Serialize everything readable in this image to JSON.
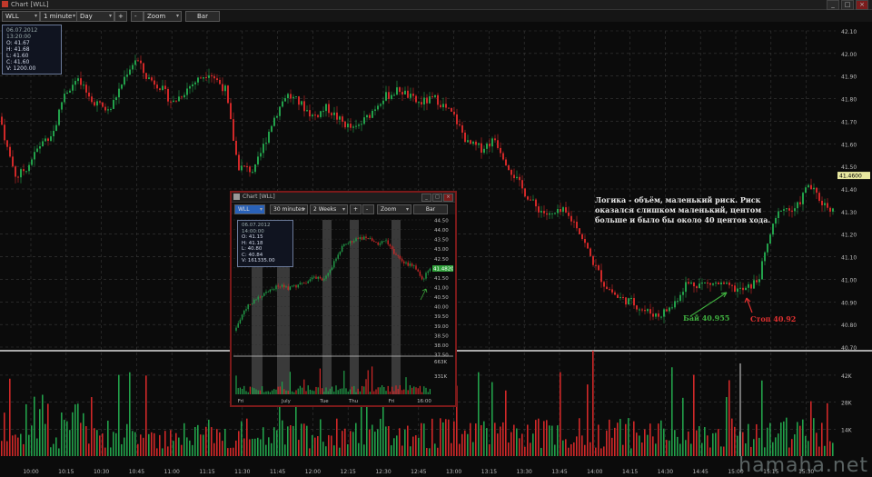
{
  "window": {
    "title": "Chart [WLL]",
    "minimize": "_",
    "maximize": "□",
    "close": "×"
  },
  "toolbar": {
    "symbol": "WLL",
    "interval": "1 minute",
    "period": "Day",
    "plus": "+",
    "minus": "-",
    "zoom": "Zoom",
    "bar": "Bar"
  },
  "infobox": {
    "date": "06.07.2012 13:20:00",
    "open": "O: 41.67",
    "high": "H: 41.68",
    "low": "L: 41.60",
    "close": "C: 41.60",
    "volume": "V: 1200.00"
  },
  "annotation": {
    "line1": "Логика - объём, маленький риск. Риск",
    "line2": "оказался слишком маленький, центом",
    "line3": "больше и было бы около 40 центов хода.",
    "buy": "Бай 40.955",
    "stop": "Стоп 40.92"
  },
  "watermark": "hamaha.net",
  "colors": {
    "up": "#22a04a",
    "down": "#d02828",
    "grid": "#3a3a3a",
    "last_price_bg": "#e8e8a0"
  },
  "chart_data": {
    "type": "candlestick",
    "price_ticks": [
      "42.10",
      "42.00",
      "41.90",
      "41.80",
      "41.70",
      "41.60",
      "41.50",
      "41.40",
      "41.30",
      "41.20",
      "41.10",
      "41.00",
      "40.90",
      "40.80",
      "40.70"
    ],
    "volume_ticks": [
      "42K",
      "28K",
      "14K"
    ],
    "time_ticks": [
      "10:00",
      "10:15",
      "10:30",
      "10:45",
      "11:00",
      "11:15",
      "11:30",
      "11:45",
      "12:00",
      "12:15",
      "12:30",
      "12:45",
      "13:00",
      "13:15",
      "13:30",
      "13:45",
      "14:00",
      "14:15",
      "14:30",
      "14:45",
      "15:00",
      "15:15",
      "15:30"
    ],
    "last_price": "41.4600",
    "ylim": [
      40.7,
      42.1
    ],
    "path": [
      [
        0,
        41.72
      ],
      [
        8,
        41.58
      ],
      [
        18,
        41.45
      ],
      [
        30,
        41.5
      ],
      [
        45,
        41.6
      ],
      [
        60,
        41.66
      ],
      [
        70,
        41.82
      ],
      [
        85,
        41.88
      ],
      [
        100,
        41.8
      ],
      [
        120,
        41.74
      ],
      [
        140,
        41.92
      ],
      [
        150,
        41.98
      ],
      [
        160,
        41.9
      ],
      [
        175,
        41.86
      ],
      [
        190,
        41.78
      ],
      [
        210,
        41.86
      ],
      [
        230,
        41.92
      ],
      [
        248,
        41.84
      ],
      [
        262,
        41.5
      ],
      [
        280,
        41.48
      ],
      [
        300,
        41.7
      ],
      [
        315,
        41.82
      ],
      [
        330,
        41.78
      ],
      [
        345,
        41.72
      ],
      [
        360,
        41.76
      ],
      [
        375,
        41.7
      ],
      [
        390,
        41.66
      ],
      [
        405,
        41.72
      ],
      [
        420,
        41.8
      ],
      [
        440,
        41.84
      ],
      [
        460,
        41.78
      ],
      [
        480,
        41.8
      ],
      [
        500,
        41.72
      ],
      [
        515,
        41.6
      ],
      [
        530,
        41.58
      ],
      [
        545,
        41.62
      ],
      [
        560,
        41.5
      ],
      [
        575,
        41.4
      ],
      [
        590,
        41.32
      ],
      [
        605,
        41.28
      ],
      [
        620,
        41.3
      ],
      [
        635,
        41.24
      ],
      [
        650,
        41.1
      ],
      [
        665,
        40.98
      ],
      [
        680,
        40.92
      ],
      [
        695,
        40.9
      ],
      [
        710,
        40.86
      ],
      [
        725,
        40.84
      ],
      [
        740,
        40.88
      ],
      [
        755,
        40.98
      ],
      [
        770,
        40.98
      ],
      [
        790,
        40.98
      ],
      [
        805,
        40.96
      ],
      [
        820,
        40.95
      ],
      [
        835,
        41.0
      ],
      [
        848,
        41.2
      ],
      [
        860,
        41.32
      ],
      [
        875,
        41.3
      ],
      [
        890,
        41.42
      ],
      [
        905,
        41.34
      ],
      [
        920,
        41.3
      ]
    ],
    "volume_spike_x": 815
  },
  "inner_chart": {
    "title": "Chart [WLL]",
    "symbol": "WLL",
    "interval": "30 minutes",
    "period": "2 Weeks",
    "zoom": "Zoom",
    "bar": "Bar",
    "info": {
      "date": "06.07.2012 14:00:00",
      "open": "O: 41.15",
      "high": "H: 41.18",
      "low": "L: 40.80",
      "close": "C: 40.84",
      "volume": "V: 161335.00"
    },
    "price_ticks": [
      "44.50",
      "44.00",
      "43.50",
      "43.00",
      "42.50",
      "42.00",
      "41.50",
      "41.00",
      "40.50",
      "40.00",
      "39.50",
      "39.00",
      "38.50",
      "38.00",
      "37.50"
    ],
    "last_price": "41.4820",
    "volume_ticks": [
      "663K",
      "331K"
    ],
    "time_ticks": [
      "Fri",
      "July",
      "Tue",
      "Thu",
      "Fri",
      "16:00"
    ]
  }
}
